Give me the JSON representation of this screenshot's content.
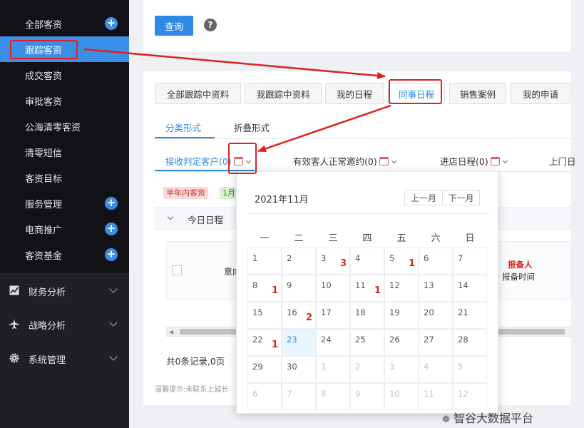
{
  "sidebar": {
    "items": [
      {
        "label": "全部客资",
        "plus": "+"
      },
      {
        "label": "跟踪客资"
      },
      {
        "label": "成交客资"
      },
      {
        "label": "审批客资"
      },
      {
        "label": "公海清零客资"
      },
      {
        "label": "清零短信"
      },
      {
        "label": "客资目标"
      },
      {
        "label": "服务管理",
        "plus": "+"
      },
      {
        "label": "电商推广",
        "plus": "+"
      },
      {
        "label": "客资基金",
        "plus": "+"
      }
    ],
    "groups": [
      {
        "label": "财务分析",
        "icon": "chart-icon"
      },
      {
        "label": "战略分析",
        "icon": "plane-icon"
      },
      {
        "label": "系统管理",
        "icon": "gear-icon"
      }
    ]
  },
  "toolbar": {
    "query_label": "查询",
    "help": "?"
  },
  "tabs": [
    "全部跟踪中资料",
    "我跟踪中资料",
    "我的日程",
    "同事日程",
    "销售案例",
    "我的申请"
  ],
  "subtabs": [
    "分类形式",
    "折叠形式"
  ],
  "filters": [
    "接收判定客户(0)",
    "有效客人正常邀约(0)",
    "进店日程(0)",
    "上门日"
  ],
  "badges": [
    "半年内客资",
    "1月"
  ],
  "table": {
    "section_title": "今日日程",
    "col_intent": "意向",
    "col_reporter": "报备人",
    "col_report_time": "报备时间",
    "footer": "共0条记录,0页",
    "tip": "温馨提示:未联系上延长"
  },
  "calendar": {
    "title": "2021年11月",
    "prev": "上一月",
    "next": "下一月",
    "weekdays": [
      "一",
      "二",
      "三",
      "四",
      "五",
      "六",
      "日"
    ],
    "weeks": [
      [
        "1",
        "2",
        "3",
        "4",
        "5",
        "6",
        "7"
      ],
      [
        "8",
        "9",
        "10",
        "11",
        "12",
        "13",
        "14"
      ],
      [
        "15",
        "16",
        "17",
        "18",
        "19",
        "20",
        "21"
      ],
      [
        "22",
        "23",
        "24",
        "25",
        "26",
        "27",
        "28"
      ],
      [
        "29",
        "30",
        "1",
        "2",
        "3",
        "4",
        "5"
      ],
      [
        "6",
        "7",
        "8",
        "9",
        "10",
        "11",
        "12"
      ]
    ],
    "counts": [
      {
        "week": 0,
        "day": 2,
        "value": "3"
      },
      {
        "week": 0,
        "day": 4,
        "value": "1"
      },
      {
        "week": 1,
        "day": 0,
        "value": "1"
      },
      {
        "week": 1,
        "day": 3,
        "value": "1"
      },
      {
        "week": 2,
        "day": 1,
        "value": "2"
      },
      {
        "week": 3,
        "day": 0,
        "value": "1"
      }
    ],
    "today": {
      "week": 3,
      "day": 1
    }
  },
  "watermark": "智谷大数据平台",
  "colors": {
    "accent": "#2e8ae6",
    "highlight": "#e02020",
    "sidebar": "#1f1f24"
  }
}
